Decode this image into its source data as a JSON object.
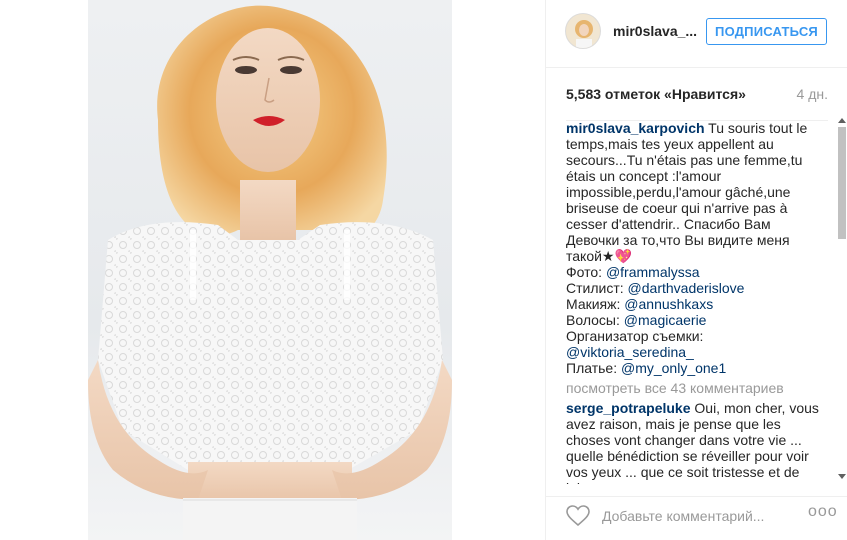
{
  "post": {
    "header": {
      "username": "mir0slava_...",
      "follow_label": "ПОДПИСАТЬСЯ"
    },
    "likes": "5,583 отметок «Нравится»",
    "age": "4 дн.",
    "caption": {
      "author": "mir0slava_karpovich",
      "text": " Tu souris tout le temps,mais tes yeux appellent au secours...Tu n'étais pas une femme,tu étais un concept :l'amour impossible,perdu,l'amour gâché,une briseuse de coeur qui n'arrive pas à cesser d'attendrir.. Спасибо Вам Девочки за то,что Вы видите меня такой★💖",
      "photo_label": "Фото:",
      "photo_mention": "@frammalyssa",
      "stylist_label": "Стилист:",
      "stylist_mention": "@darthvaderislove",
      "makeup_label": "Макияж:",
      "makeup_mention": "@annushkaxs",
      "hair_label": "Волосы:",
      "hair_mention": "@magicaerie",
      "organizer_label": "Организатор съемки:",
      "organizer_mention": "@viktoria_seredina_",
      "dress_label": "Платье:",
      "dress_mention": "@my_only_one1"
    },
    "view_all": "посмотреть все 43 комментариев",
    "comment": {
      "author": "serge_potrapeluke",
      "text": " Oui, mon cher, vous avez raison, mais je pense que les choses vont changer dans votre vie ... quelle bénédiction se réveiller pour voir vos yeux ... que ce soit tristesse et de joie"
    },
    "footer": {
      "placeholder": "Добавьте комментарий...",
      "more": "ooo"
    }
  },
  "icons": {
    "heart": "heart-icon",
    "more": "more-options-icon"
  },
  "colors": {
    "accent": "#3897f0",
    "link": "#003569",
    "muted": "#999999",
    "border": "#efefef"
  }
}
